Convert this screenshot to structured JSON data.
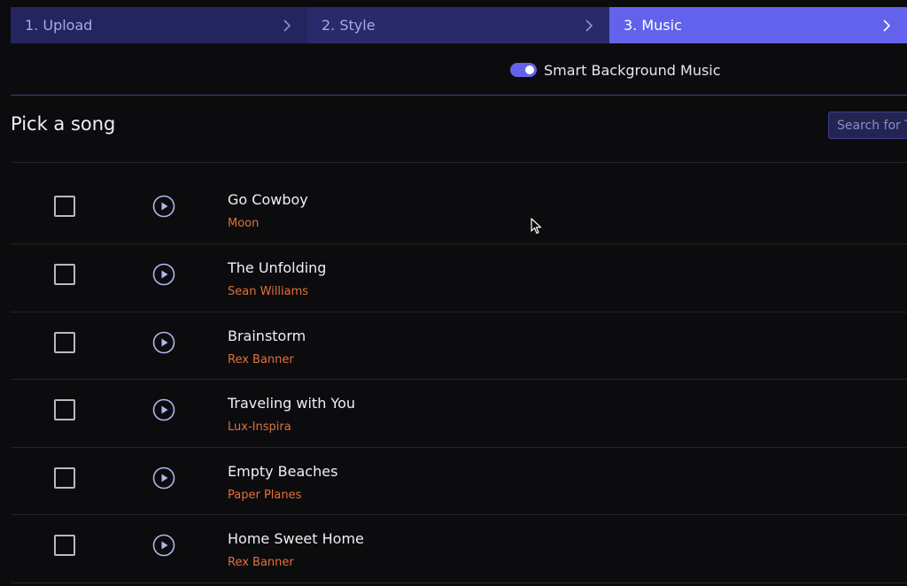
{
  "stepper": {
    "steps": [
      {
        "label": "1. Upload",
        "active": false
      },
      {
        "label": "2. Style",
        "active": false
      },
      {
        "label": "3. Music",
        "active": true
      }
    ]
  },
  "options": {
    "smart_music_label": "Smart Background Music",
    "smart_music_enabled": true
  },
  "section": {
    "title": "Pick a song"
  },
  "search": {
    "placeholder": "Search for T"
  },
  "songs": [
    {
      "title": "Go Cowboy",
      "artist": "Moon",
      "checked": false
    },
    {
      "title": "The Unfolding",
      "artist": "Sean Williams",
      "checked": false
    },
    {
      "title": "Brainstorm",
      "artist": "Rex Banner",
      "checked": false
    },
    {
      "title": "Traveling with You",
      "artist": "Lux-Inspira",
      "checked": false
    },
    {
      "title": "Empty Beaches",
      "artist": "Paper Planes",
      "checked": false
    },
    {
      "title": "Home Sweet Home",
      "artist": "Rex Banner",
      "checked": false
    }
  ],
  "colors": {
    "accent": "#6262ec",
    "inactive_step": "#2a2a68",
    "artist": "#e0703a",
    "background": "#0c0c0e"
  }
}
